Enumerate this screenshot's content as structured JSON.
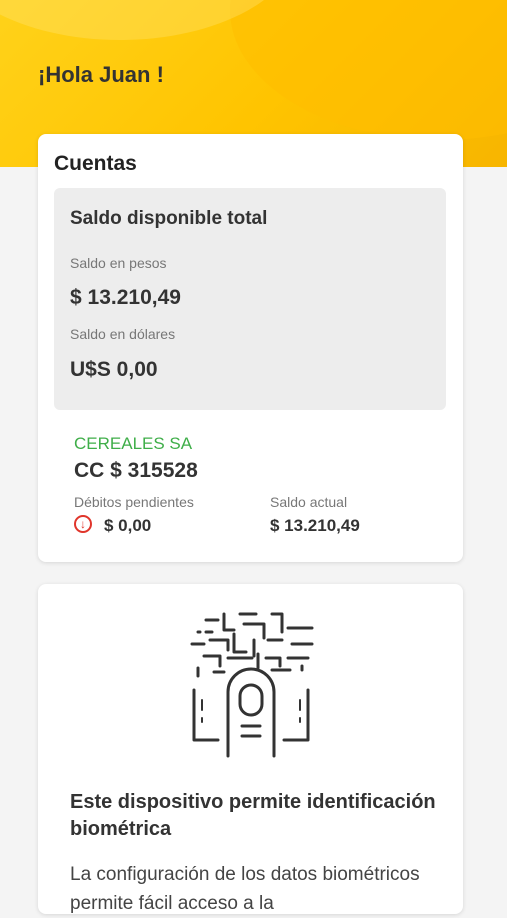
{
  "header": {
    "greeting": "¡Hola Juan !"
  },
  "accounts": {
    "title": "Cuentas",
    "balance": {
      "title": "Saldo disponible total",
      "pesos_label": "Saldo en pesos",
      "pesos_value": "$ 13.210,49",
      "dollars_label": "Saldo en dólares",
      "dollars_value": "U$S 0,00"
    },
    "account": {
      "name": "CEREALES SA",
      "number": "CC $ 315528",
      "pending_label": "Débitos pendientes",
      "pending_value": "$ 0,00",
      "current_label": "Saldo actual",
      "current_value": "$ 13.210,49"
    }
  },
  "biometric": {
    "icon": "fingerprint-circuit-icon",
    "title": "Este dispositivo permite identificación biométrica",
    "text": "La configuración de los datos biométricos permite fácil acceso a la"
  },
  "colors": {
    "header_yellow": "#ffc400",
    "account_green": "#3fae49",
    "debit_red": "#e0352b"
  }
}
